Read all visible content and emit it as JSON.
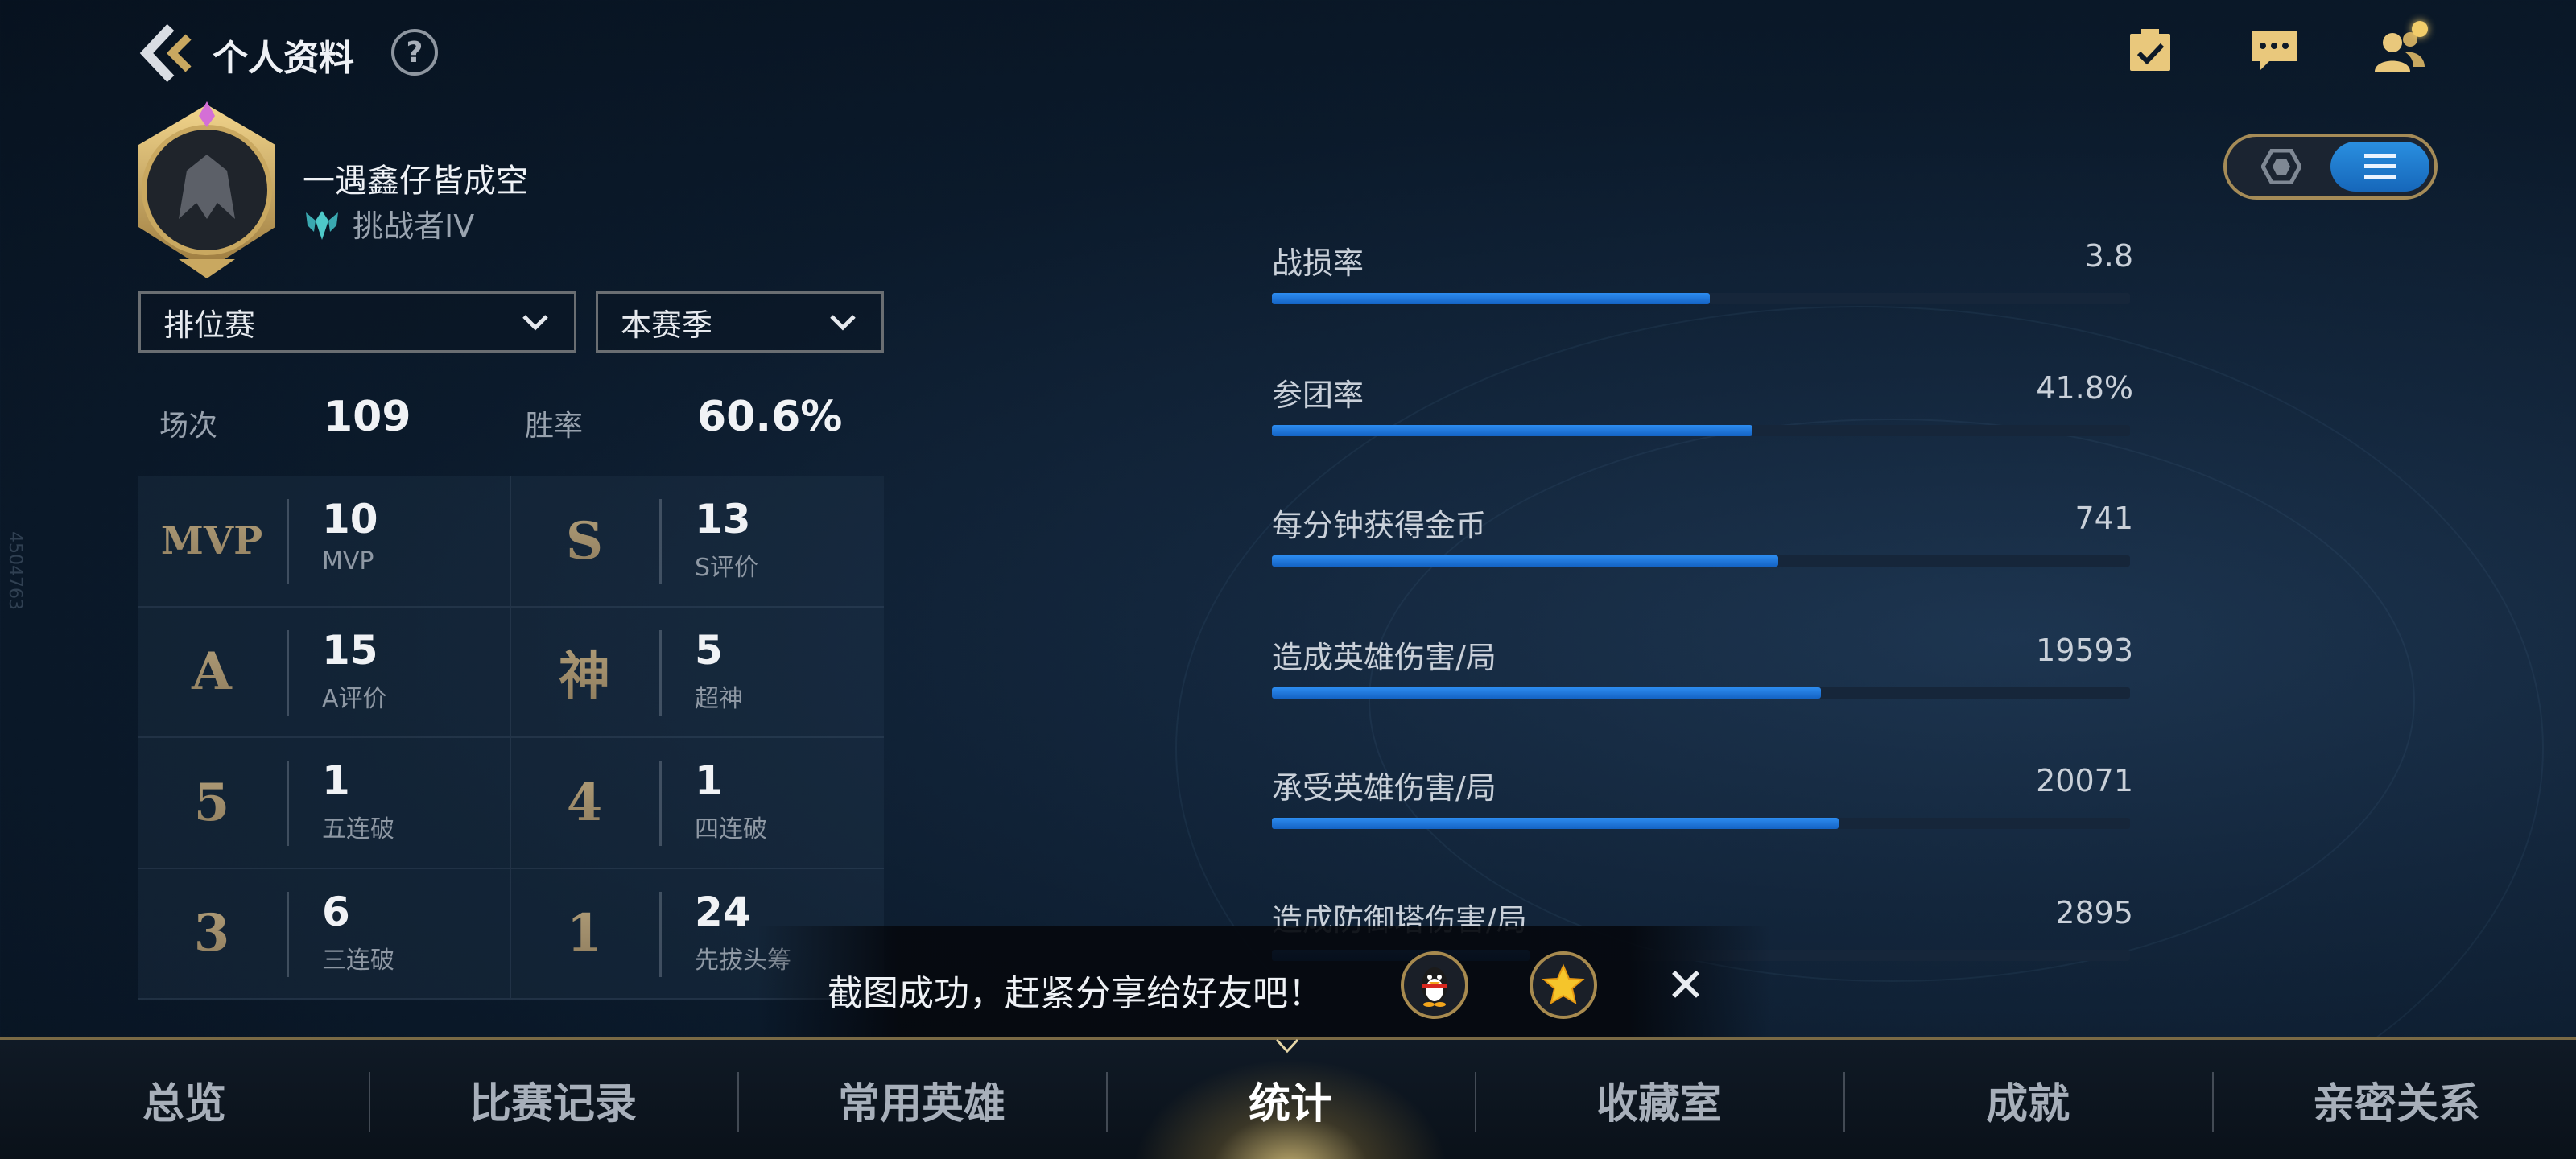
{
  "header": {
    "title": "个人资料",
    "help_label": "?"
  },
  "topbar_icons": [
    "task-list-icon",
    "chat-icon",
    "friends-icon"
  ],
  "profile": {
    "name": "一遇鑫仔皆成空",
    "rank": "挑战者IV"
  },
  "view_toggle": {
    "options": [
      "hexagon-icon",
      "list-icon"
    ],
    "active": "list-icon"
  },
  "filters": {
    "mode": "排位赛",
    "season": "本赛季"
  },
  "summary": {
    "matches_label": "场次",
    "matches_value": "109",
    "winrate_label": "胜率",
    "winrate_value": "60.6%"
  },
  "stats": [
    {
      "icon": "MVP",
      "value": "10",
      "caption": "MVP"
    },
    {
      "icon": "S",
      "value": "13",
      "caption": "S评价"
    },
    {
      "icon": "A",
      "value": "15",
      "caption": "A评价"
    },
    {
      "icon": "神",
      "value": "5",
      "caption": "超神"
    },
    {
      "icon": "5",
      "value": "1",
      "caption": "五连破"
    },
    {
      "icon": "4",
      "value": "1",
      "caption": "四连破"
    },
    {
      "icon": "3",
      "value": "6",
      "caption": "三连破"
    },
    {
      "icon": "1",
      "value": "24",
      "caption": "先拔头筹"
    }
  ],
  "bars": [
    {
      "label": "战损率",
      "value": "3.8",
      "fill": 0.51
    },
    {
      "label": "参团率",
      "value": "41.8%",
      "fill": 0.56
    },
    {
      "label": "每分钟获得金币",
      "value": "741",
      "fill": 0.59
    },
    {
      "label": "造成英雄伤害/局",
      "value": "19593",
      "fill": 0.64
    },
    {
      "label": "承受英雄伤害/局",
      "value": "20071",
      "fill": 0.66
    },
    {
      "label": "造成防御塔伤害/局",
      "value": "2895",
      "fill": 0.3
    }
  ],
  "toast": {
    "message": "截图成功，赶紧分享给好友吧！",
    "share_targets": [
      "qq-penguin-icon",
      "qzone-star-icon"
    ]
  },
  "tabs": [
    "总览",
    "比赛记录",
    "常用英雄",
    "统计",
    "收藏室",
    "成就",
    "亲密关系"
  ],
  "active_tab": "统计",
  "watermark": "4504763",
  "colors": {
    "accent_blue": "#1e7ad8",
    "gold": "#a58b57"
  }
}
